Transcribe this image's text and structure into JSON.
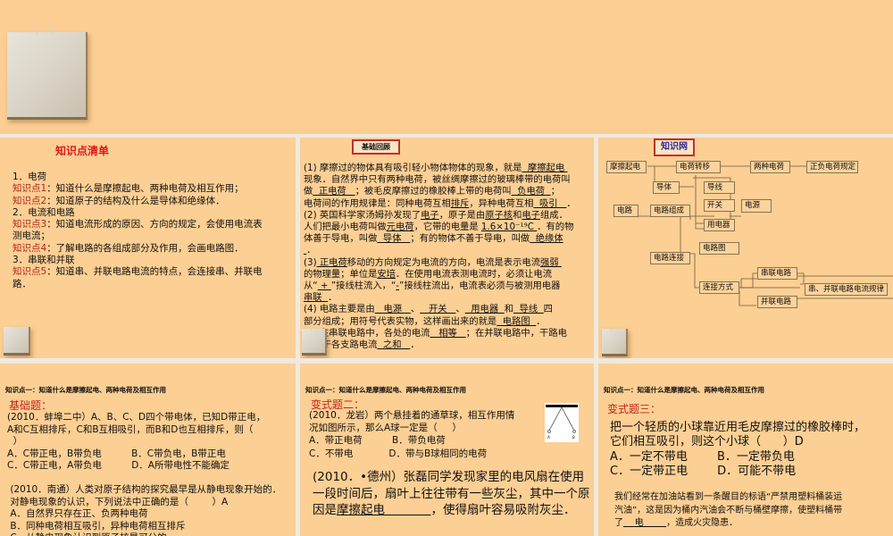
{
  "colors": {
    "background": "#fccf94",
    "accent_red": "#b0261c",
    "title_red": "#e0181a",
    "box_border": "#8a7250"
  },
  "slide1": {
    "title": "知识点清单",
    "lines": [
      [
        {
          "t": "1．电荷"
        }
      ],
      [
        {
          "t": "知识点1",
          "c": "r"
        },
        {
          "t": "：知道什么是摩擦起电、两种电荷及相互作用；"
        }
      ],
      [
        {
          "t": "知识点2",
          "c": "r"
        },
        {
          "t": "：知道原子的结构及什么是导体和绝缘体．"
        }
      ],
      [
        {
          "t": "2．电流和电路"
        }
      ],
      [
        {
          "t": "知识点3",
          "c": "r"
        },
        {
          "t": "：知道电流形成的原因、方向的规定，会使用电流表"
        }
      ],
      [
        {
          "t": "测电流；"
        }
      ],
      [
        {
          "t": "知识点4",
          "c": "r"
        },
        {
          "t": "：了解电路的各组成部分及作用，会画电路图．"
        }
      ],
      [
        {
          "t": "3．串联和并联"
        }
      ],
      [
        {
          "t": "知识点5",
          "c": "r"
        },
        {
          "t": "：知道串、并联电路电流的特点，会连接串、并联电"
        }
      ],
      [
        {
          "t": "路．"
        }
      ]
    ]
  },
  "slide2": {
    "title": "基础回顾",
    "lines": [
      [
        {
          "t": "(1) 摩擦过的物体具有吸引轻小物体物体的现象，就是"
        },
        {
          "t": "  摩擦起电 ",
          "u": true
        }
      ],
      [
        {
          "t": "现象．自然界中只有两种电荷，被丝绸摩擦过的玻璃棒带的电荷叫"
        }
      ],
      [
        {
          "t": "做"
        },
        {
          "t": "  正电荷   ",
          "u": true
        },
        {
          "t": "；被毛皮摩擦过的橡胶棒上带的电荷叫"
        },
        {
          "t": "  负电荷  ",
          "u": true
        },
        {
          "t": "；"
        }
      ],
      [
        {
          "t": "电荷间的作用规律是：同种电荷互相"
        },
        {
          "t": "排斥",
          "u": true
        },
        {
          "t": "，异种电荷互相"
        },
        {
          "t": "  吸引   ",
          "u": true
        },
        {
          "t": "．"
        }
      ],
      [
        {
          "t": "(2) 英国科学家汤姆孙发现了"
        },
        {
          "t": "电子",
          "u": true
        },
        {
          "t": "，原子是由"
        },
        {
          "t": "原子核",
          "u": true
        },
        {
          "t": "和"
        },
        {
          "t": "电子",
          "u": true
        },
        {
          "t": "组成．"
        }
      ],
      [
        {
          "t": "人们把最小电荷叫做"
        },
        {
          "t": "元电荷",
          "u": true
        },
        {
          "t": "，它带的电量是 "
        },
        {
          "t": "1.6×10⁻¹⁹C ",
          "u": true
        },
        {
          "t": "．有的物"
        }
      ],
      [
        {
          "t": "体善于导电，叫做"
        },
        {
          "t": "  导体   ",
          "u": true
        },
        {
          "t": "；有的物体不善于导电，叫做"
        },
        {
          "t": "  绝缘体",
          "u": true
        }
      ],
      [
        {
          "t": " ",
          "u": true
        },
        {
          "t": "．"
        }
      ],
      [
        {
          "t": "(3)"
        },
        {
          "t": " 正电荷",
          "u": true
        },
        {
          "t": "移动的方向规定为电流的方向，电流是表示电流"
        },
        {
          "t": "强弱 ",
          "u": true
        }
      ],
      [
        {
          "t": "的物理量；单位是"
        },
        {
          "t": "安培",
          "u": true
        },
        {
          "t": "．在使用电流表测电流时，必须让电流"
        }
      ],
      [
        {
          "t": "从“"
        },
        {
          "t": " + ",
          "u": true
        },
        {
          "t": "”接线柱流入，“"
        },
        {
          "t": "-",
          "u": true
        },
        {
          "t": "”接线柱流出，电流表必须与被测用电器"
        }
      ],
      [
        {
          "t": "串联  ",
          "u": true
        },
        {
          "t": "．"
        }
      ],
      [
        {
          "t": "(4) 电路主要是由"
        },
        {
          "t": "   电源   ",
          "u": true
        },
        {
          "t": "、"
        },
        {
          "t": "   开关   ",
          "u": true
        },
        {
          "t": "、"
        },
        {
          "t": "  用电器  ",
          "u": true
        },
        {
          "t": "和"
        },
        {
          "t": "  导线  ",
          "u": true
        },
        {
          "t": "四"
        }
      ],
      [
        {
          "t": "部分组成；用符号代表实物，这样画出来的就是"
        },
        {
          "t": "  电路图  ",
          "u": true
        },
        {
          "t": "．"
        }
      ],
      [
        {
          "t": "(5) 在串联电路中，各处的电流"
        },
        {
          "t": "   相等   ",
          "u": true
        },
        {
          "t": "；在并联电路中，干路电"
        }
      ],
      [
        {
          "t": "流等于各支路电流"
        },
        {
          "t": "  之和   ",
          "u": true
        },
        {
          "t": "．"
        }
      ]
    ]
  },
  "slide3": {
    "title": "知识网",
    "nodes": {
      "mcqd": "摩擦起电",
      "dhzy": "电荷转移",
      "lzdh": "两种电荷",
      "zfdh": "正负电荷规定",
      "dt": "导体",
      "dx": "导线",
      "dl": "电路",
      "dlzc": "电路组成",
      "kg": "开关",
      "dy": "电源",
      "yqd": "用电器",
      "dlt": "电路图",
      "dllj": "电路连接",
      "cldl": "串联电路",
      "ljfs": "连接方式",
      "gl": "串、并联电路电流规律",
      "bldl": "并联电路"
    }
  },
  "slide4": {
    "header": "知识点一：知道什么是摩擦起电、两种电荷及相互作用",
    "subtitle": "基础题：",
    "lines": [
      [
        {
          "t": "(2010．蚌埠二中）A、B、C、D四个带电体，已知D带正电，"
        }
      ],
      [
        {
          "t": "A和C互相排斥，C和B互相吸引，而B和D也互相排斥，则（"
        }
      ],
      [
        {
          "t": "  ）"
        }
      ],
      [
        {
          "t": "A．C带正电，B带负电          B．C带负电，B带正电"
        }
      ],
      [
        {
          "t": "C．C带正电，A带负电          D．A所带电性不能确定"
        }
      ],
      [
        {
          "t": " "
        }
      ],
      [
        {
          "t": " (2010．南通）人类对原子结构的探究最早是从静电现象开始的．"
        }
      ],
      [
        {
          "t": " 对静电现象的认识，下列说法中正确的是（        ）A"
        }
      ],
      [
        {
          "t": " A．自然界只存在正、负两种电荷"
        }
      ],
      [
        {
          "t": " B．同种电荷相互吸引，异种电荷相互排斥"
        }
      ],
      [
        {
          "t": " C．从静电现象认识到原子核是可分的"
        }
      ]
    ]
  },
  "slide5": {
    "header": "知识点一：知道什么是摩擦起电、两种电荷及相互作用",
    "subtitle": "变式题二：",
    "lines": [
      [
        {
          "t": "(2010．龙岩）两个悬挂着的通草球，相互作用情"
        }
      ],
      [
        {
          "t": "况如图所示，那么A球一定是（     ）"
        }
      ],
      [
        {
          "t": "A．带正电荷          B．带负电荷"
        }
      ],
      [
        {
          "t": "C．不带电            D．带与B球相同的电荷"
        }
      ]
    ],
    "big_lines": [
      [
        {
          "t": "(2010．•德州）张磊同学发现家里的电风扇在使用"
        }
      ],
      [
        {
          "t": "一段时间后，扇叶上往往带有一些灰尘，其中一个原"
        }
      ],
      [
        {
          "t": "因是"
        },
        {
          "t": "摩擦起电            ",
          "u": true
        },
        {
          "t": "，使得扇叶容易吸附灰尘．"
        }
      ]
    ],
    "figure_labels": {
      "a": "A",
      "b": "B"
    }
  },
  "slide6": {
    "header": "知识点一：知道什么是摩擦起电、两种电荷及相互作用",
    "subtitle": "变式题三：",
    "big_lines": [
      [
        {
          "t": "把一个轻质的小球靠近用毛皮摩擦过的橡胶棒时，"
        }
      ],
      [
        {
          "t": "它们相互吸引，则这个小球（      ）D"
        }
      ],
      [
        {
          "t": "A．一定不带电        B．一定带负电"
        }
      ],
      [
        {
          "t": "C．一定带正电        D．可能不带电"
        }
      ]
    ],
    "lines": [
      [
        {
          "t": "我们经常在加油站看到一条醒目的标语“严禁用塑料桶装运"
        }
      ],
      [
        {
          "t": "汽油”，这是因为桶内汽油会不断与桶壁摩擦，使塑料桶带"
        }
      ],
      [
        {
          "t": "了"
        },
        {
          "t": "    电        ",
          "u": true
        },
        {
          "t": "，造成火灾隐患．"
        }
      ]
    ]
  }
}
